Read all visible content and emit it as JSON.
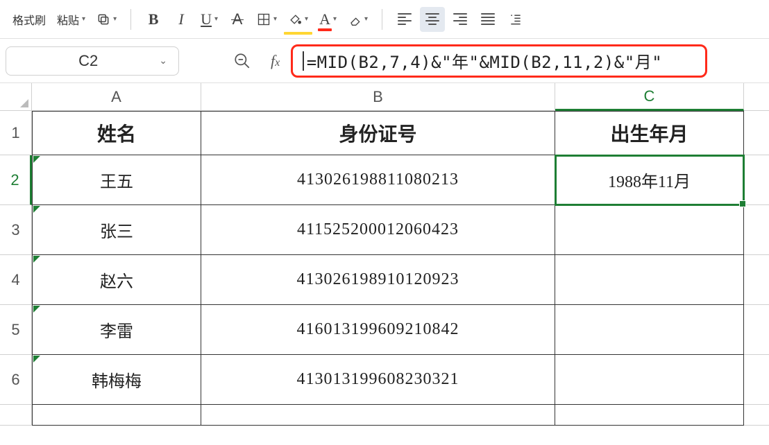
{
  "toolbar": {
    "format_painter": "格式刷",
    "paste": "粘贴"
  },
  "namebox": {
    "value": "C2"
  },
  "formula_bar": {
    "value": "=MID(B2,7,4)&\"年\"&MID(B2,11,2)&\"月\""
  },
  "columns": [
    "A",
    "B",
    "C"
  ],
  "row_numbers": [
    "1",
    "2",
    "3",
    "4",
    "5",
    "6"
  ],
  "headers": {
    "A": "姓名",
    "B": "身份证号",
    "C": "出生年月"
  },
  "rows": [
    {
      "name": "王五",
      "id": "413026198811080213",
      "birth": "1988年11月"
    },
    {
      "name": "张三",
      "id": "411525200012060423",
      "birth": ""
    },
    {
      "name": "赵六",
      "id": "413026198910120923",
      "birth": ""
    },
    {
      "name": "李雷",
      "id": "416013199609210842",
      "birth": ""
    },
    {
      "name": "韩梅梅",
      "id": "413013199608230321",
      "birth": ""
    }
  ],
  "selected_cell": "C2",
  "selected_row": 2,
  "selected_col": "C"
}
